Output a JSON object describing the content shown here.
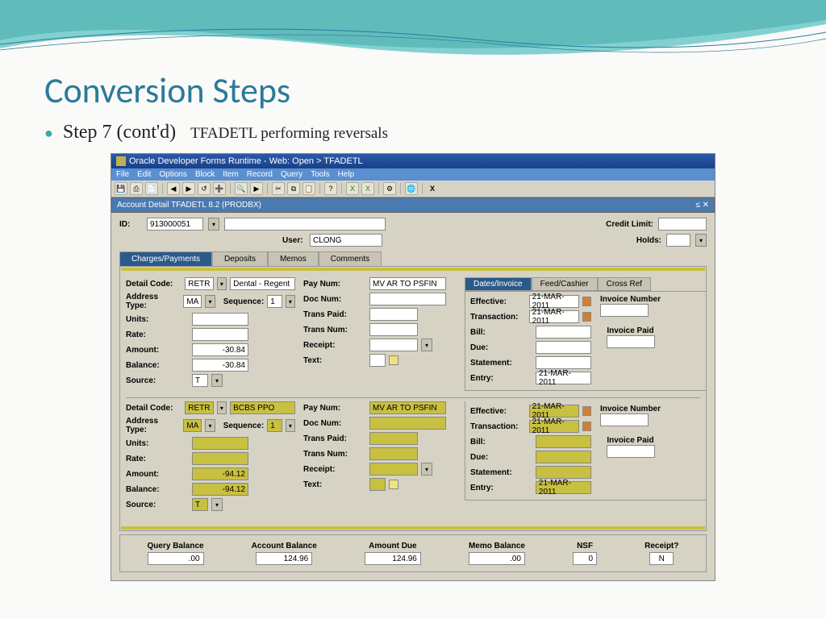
{
  "slide": {
    "title": "Conversion Steps",
    "bullet": "Step 7 (cont'd)",
    "sub": "TFADETL performing reversals"
  },
  "window": {
    "title": "Oracle Developer Forms Runtime - Web: Open > TFADETL",
    "menus": [
      "File",
      "Edit",
      "Options",
      "Block",
      "Item",
      "Record",
      "Query",
      "Tools",
      "Help"
    ],
    "subform_title": "Account Detail  TFADETL  8.2  (PRODBX)"
  },
  "header": {
    "id_label": "ID:",
    "id_value": "913000051",
    "user_label": "User:",
    "user_value": "CLONG",
    "credit_label": "Credit Limit:",
    "holds_label": "Holds:"
  },
  "main_tabs": [
    "Charges/Payments",
    "Deposits",
    "Memos",
    "Comments"
  ],
  "right_tabs": [
    "Dates/Invoice",
    "Feed/Cashier",
    "Cross Ref"
  ],
  "labels": {
    "detail_code": "Detail Code:",
    "address_type": "Address Type:",
    "sequence": "Sequence:",
    "units": "Units:",
    "rate": "Rate:",
    "amount": "Amount:",
    "balance": "Balance:",
    "source": "Source:",
    "pay_num": "Pay Num:",
    "doc_num": "Doc Num:",
    "trans_paid": "Trans Paid:",
    "trans_num": "Trans Num:",
    "receipt": "Receipt:",
    "text": "Text:",
    "effective": "Effective:",
    "transaction": "Transaction:",
    "bill": "Bill:",
    "due": "Due:",
    "statement": "Statement:",
    "entry": "Entry:",
    "invoice_number": "Invoice Number",
    "invoice_paid": "Invoice Paid"
  },
  "records": [
    {
      "detail_code": "RETR",
      "detail_desc": "Dental - Regent",
      "address_type": "MA",
      "sequence": "1",
      "amount": "-30.84",
      "balance": "-30.84",
      "source": "T",
      "pay_num": "MV AR TO PSFIN",
      "effective": "21-MAR-2011",
      "transaction": "21-MAR-2011",
      "entry": "21-MAR-2011",
      "highlight": false
    },
    {
      "detail_code": "RETR",
      "detail_desc": "BCBS PPO",
      "address_type": "MA",
      "sequence": "1",
      "amount": "-94.12",
      "balance": "-94.12",
      "source": "T",
      "pay_num": "MV AR TO PSFIN",
      "effective": "21-MAR-2011",
      "transaction": "21-MAR-2011",
      "entry": "21-MAR-2011",
      "highlight": true
    }
  ],
  "footer": {
    "query_balance_lbl": "Query Balance",
    "query_balance": ".00",
    "account_balance_lbl": "Account Balance",
    "account_balance": "124.96",
    "amount_due_lbl": "Amount Due",
    "amount_due": "124.96",
    "memo_balance_lbl": "Memo Balance",
    "memo_balance": ".00",
    "nsf_lbl": "NSF",
    "nsf": "0",
    "receipt_lbl": "Receipt?",
    "receipt": "N"
  }
}
